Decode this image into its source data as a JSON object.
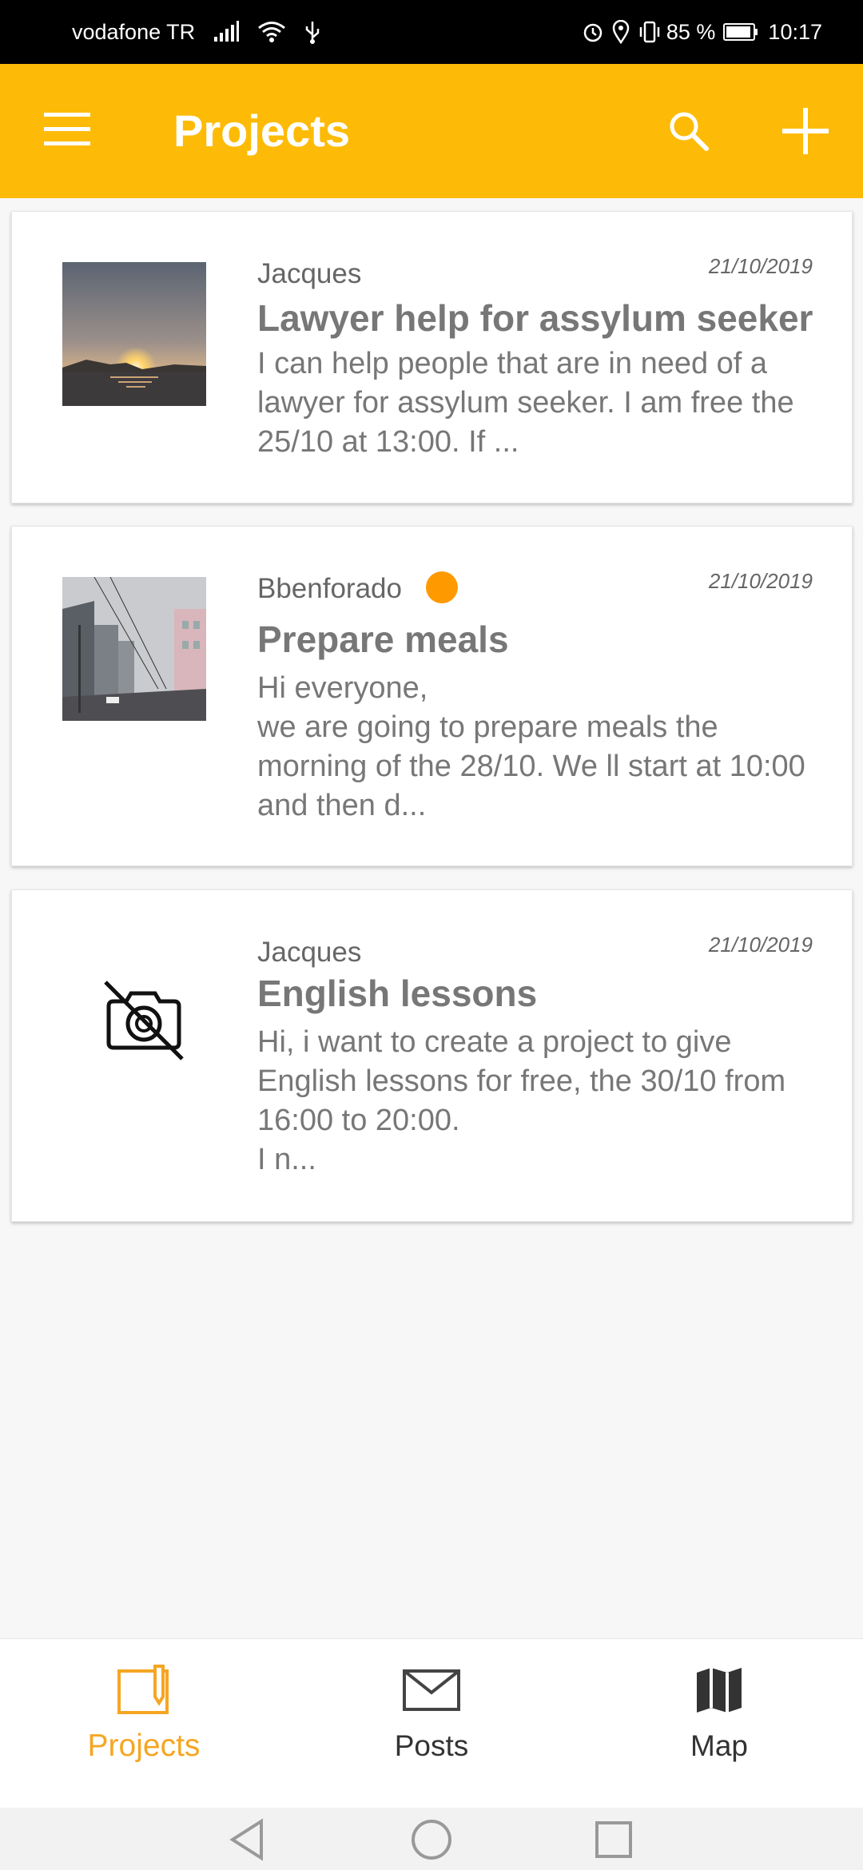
{
  "status_bar": {
    "carrier": "vodafone TR",
    "battery": "85 %",
    "time": "10:17",
    "icons": [
      "signal-icon",
      "wifi-icon",
      "usb-icon",
      "alarm-icon",
      "location-icon",
      "vibrate-icon",
      "battery-icon"
    ]
  },
  "app_bar": {
    "title": "Projects",
    "background_color": "#FDBB08",
    "icons": [
      "menu-icon",
      "search-icon",
      "add-icon"
    ]
  },
  "projects": [
    {
      "author": "Jacques",
      "date": "21/10/2019",
      "title": "Lawyer help for assylum seeker",
      "description": "I can help people that are in need of a lawyer for assylum seeker. I am free the 25/10 at 13:00. If ...",
      "image": "sunset-photo",
      "online": false
    },
    {
      "author": "Bbenforado",
      "date": "21/10/2019",
      "title": "Prepare meals",
      "description": "Hi everyone,\nwe are going to prepare meals the morning of the 28/10. We ll start at 10:00 and then d...",
      "image": "street-photo",
      "online": true,
      "status_color": "#FF9900"
    },
    {
      "author": "Jacques",
      "date": "21/10/2019",
      "title": "English lessons",
      "description": "Hi, i want to create a project to give English lessons for free, the 30/10 from 16:00 to 20:00.\nI n...",
      "image": "no-photo-icon",
      "online": false
    }
  ],
  "bottom_nav": {
    "active_color": "#F5A623",
    "items": [
      {
        "label": "Projects",
        "icon": "projects-icon",
        "active": true
      },
      {
        "label": "Posts",
        "icon": "envelope-icon",
        "active": false
      },
      {
        "label": "Map",
        "icon": "map-icon",
        "active": false
      }
    ]
  },
  "system_nav": {
    "icons": [
      "back-icon",
      "home-icon",
      "recents-icon"
    ]
  }
}
